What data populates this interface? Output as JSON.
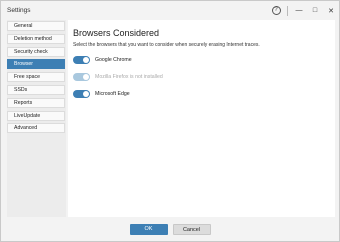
{
  "window": {
    "title": "Settings",
    "help_label": "?",
    "minimize_label": "—",
    "maximize_label": "□",
    "close_label": "✕"
  },
  "sidebar": {
    "items": [
      {
        "label": "General"
      },
      {
        "label": "Deletion method"
      },
      {
        "label": "Security check"
      },
      {
        "label": "Browser"
      },
      {
        "label": "Free space"
      },
      {
        "label": "SSDs"
      },
      {
        "label": "Reports"
      },
      {
        "label": "LiveUpdate"
      },
      {
        "label": "Advanced"
      }
    ],
    "active": "Browser"
  },
  "main": {
    "title": "Browsers Considered",
    "subtitle": "Select the browsers that you want to consider when securely erasing Internet traces.",
    "browsers": [
      {
        "label": "Google Chrome",
        "enabled": true
      },
      {
        "label": "Mozilla Firefox is not installed",
        "enabled": false
      },
      {
        "label": "Microsoft Edge",
        "enabled": true
      }
    ]
  },
  "footer": {
    "ok_label": "OK",
    "cancel_label": "Cancel"
  },
  "colors": {
    "accent": "#3d7fb4",
    "disabled_toggle": "#a9c8de"
  }
}
